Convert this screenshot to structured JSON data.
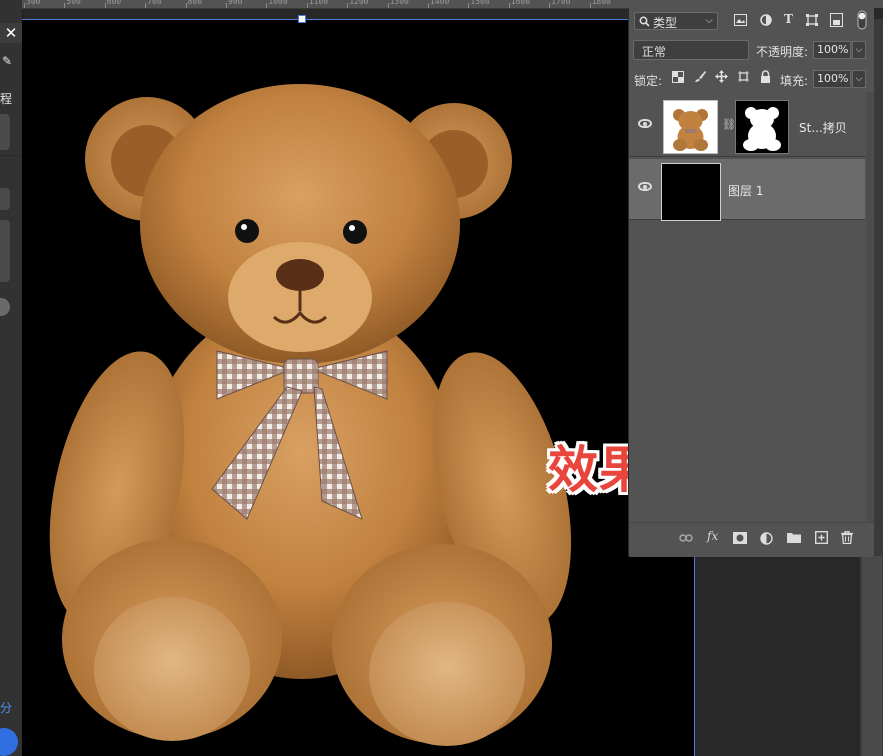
{
  "ruler": {
    "ticks": [
      "300",
      "500",
      "600",
      "700",
      "800",
      "900",
      "1000",
      "1100",
      "1200",
      "1300",
      "1400",
      "1500",
      "1600",
      "1700",
      "1800"
    ]
  },
  "left_panel": {
    "close_glyph": "✕",
    "pen_glyph": "✎",
    "label_1": "程",
    "label_2": "分"
  },
  "canvas": {
    "caption": "效果展示"
  },
  "layers_panel": {
    "filter": {
      "label": "类型",
      "icons": [
        "search-icon",
        "image-filter-icon",
        "adjustment-filter-icon",
        "type-filter-icon",
        "shape-filter-icon",
        "smart-object-filter-icon",
        "toggle-filter-icon"
      ]
    },
    "blend_mode": "正常",
    "opacity_label": "不透明度:",
    "opacity_value": "100%",
    "lock_label": "锁定:",
    "fill_label": "填充:",
    "fill_value": "100%",
    "layers": [
      {
        "name": "St...拷贝",
        "visible": true,
        "active": false,
        "has_mask": true
      },
      {
        "name": "图层 1",
        "visible": true,
        "active": true,
        "has_mask": false
      }
    ],
    "bottom_icons": [
      "link-icon",
      "fx-icon",
      "mask-icon",
      "adjustment-icon",
      "folder-icon",
      "new-layer-icon",
      "trash-icon"
    ]
  },
  "colors": {
    "accent_blue": "#4a7fd8",
    "caption_red": "#e8453c",
    "panel_bg": "#535353"
  }
}
